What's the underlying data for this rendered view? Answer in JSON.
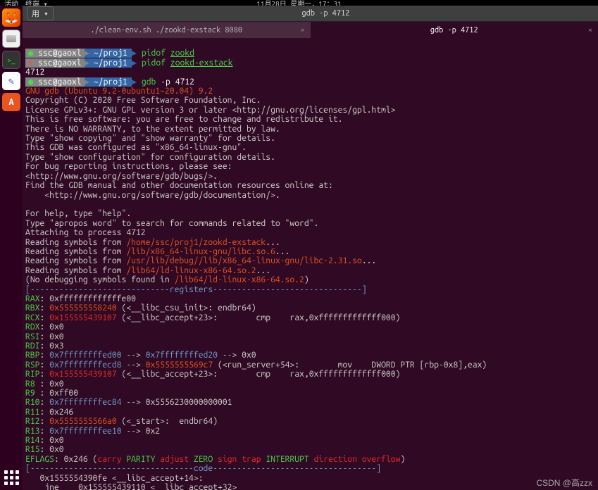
{
  "panel": {
    "activities": "活动",
    "term_label": "终端 ▾",
    "clock": "11月28日 星期一，17：31"
  },
  "window": {
    "title": "gdb -p 4712",
    "tab_control": "用 ▾"
  },
  "tabs": {
    "inactive": "./clean-env.sh ./zookd-exstack 8080",
    "active": "gdb -p 4712",
    "close": "×"
  },
  "prompt": {
    "user": "ssc@gaoxl",
    "path": "~/proj1",
    "pidof": "pidof",
    "zookd": "zookd",
    "zookd_exstack": "zookd-exstack",
    "pid": "4712",
    "gdb_cmd": "gdb",
    "gdb_arg": "-p 4712"
  },
  "gdb": {
    "banner1": "GNU gdb (Ubuntu 9.2-0ubuntu1~20.04) 9.2",
    "l1": "Copyright (C) 2020 Free Software Foundation, Inc.",
    "l2": "License GPLv3+: GNU GPL version 3 or later <http://gnu.org/licenses/gpl.html>",
    "l3": "This is free software: you are free to change and redistribute it.",
    "l4": "There is NO WARRANTY, to the extent permitted by law.",
    "l5": "Type \"show copying\" and \"show warranty\" for details.",
    "l6": "This GDB was configured as \"x86_64-linux-gnu\".",
    "l7": "Type \"show configuration\" for configuration details.",
    "l8": "For bug reporting instructions, please see:",
    "l9": "<http://www.gnu.org/software/gdb/bugs/>.",
    "l10": "Find the GDB manual and other documentation resources online at:",
    "l11": "    <http://www.gnu.org/software/gdb/documentation/>.",
    "blank": "",
    "l12": "For help, type \"help\".",
    "l13": "Type \"apropos word\" to search for commands related to \"word\".",
    "l14": "Attaching to process 4712",
    "rs_pre": "Reading symbols from ",
    "rs1": "/home/ssc/proj1/zookd-exstack",
    "rs2": "/lib/x86_64-linux-gnu/libc.so.6",
    "rs3": "/usr/lib/debug//lib/x86_64-linux-gnu/libc-2.31.so",
    "rs4": "/lib64/ld-linux-x86-64.so.2",
    "rs_suf": "...",
    "nodbg_pre": "(No debugging symbols found in ",
    "nodbg_path": "/lib64/ld-linux-x86-64.so.2",
    "nodbg_suf": ")",
    "hdr_regs_pre": "[-----------------------------",
    "hdr_regs_txt": "registers",
    "hdr_regs_suf": "-------------------------------]",
    "hdr_code_pre": "[----------------------------------",
    "hdr_code_txt": "code",
    "hdr_code_suf": "----------------------------------]",
    "eflags_label": "EFLAGS",
    "carry": "carry",
    "parity": "PARITY",
    "adjust": "adjust",
    "zero": "ZERO",
    "sign": "sign",
    "trap": "trap",
    "interrupt": "INTERRUPT",
    "direction": "direction",
    "overflow": "overflow"
  },
  "regs": {
    "RAX": {
      "val": ": 0xfffffffffffffe00"
    },
    "RBX": {
      "addr": "0x555555558240",
      "tail": " (<__libc_csu_init>: endbr64)"
    },
    "RCX": {
      "addr": "0x155555439107",
      "tail": " (<__libc_accept+23>:        cmp    rax,0xfffffffffffff000)"
    },
    "RDX": {
      "val": ": 0x0"
    },
    "RSI": {
      "val": ": 0x0"
    },
    "RDI": {
      "val": ": 0x3"
    },
    "RBP": {
      "addr1": "0x7ffffffffed00",
      "arrow": " --> ",
      "addr2": "0x7ffffffffed20",
      "tail": " --> 0x0"
    },
    "RSP": {
      "addr1": "0x7ffffffffecd8",
      "arrow": " --> ",
      "addr2": "0x5555555569c7",
      "tail": " (<run_server+54>:        mov    DWORD PTR [rbp-0x8],eax)"
    },
    "RIP": {
      "addr": "0x155555439107",
      "tail": " (<__libc_accept+23>:        cmp    rax,0xfffffffffffff000)"
    },
    "R8": {
      "val": ": 0x0"
    },
    "R9": {
      "val": ": 0xff00"
    },
    "R10": {
      "addr": "0x7ffffffffec84",
      "tail": " --> 0x5556230000000001"
    },
    "R11": {
      "val": ": 0x246"
    },
    "R12": {
      "addr": "0x5555555566a0",
      "tail": " (<_start>:  endbr64)"
    },
    "R13": {
      "addr": "0x7ffffffffee10",
      "tail": " --> 0x2"
    },
    "R14": {
      "val": ": 0x0"
    },
    "R15": {
      "val": ": 0x0"
    },
    "EFLAGS_val": ": 0x246 (",
    "EFLAGS_close": ")"
  },
  "code": {
    "l1": "   0x1555554390fe <__libc_accept+14>:",
    "l2": "    jne    0x155555439110 <__libc_accept+32>"
  },
  "watermark": "CSDN @高zzx"
}
